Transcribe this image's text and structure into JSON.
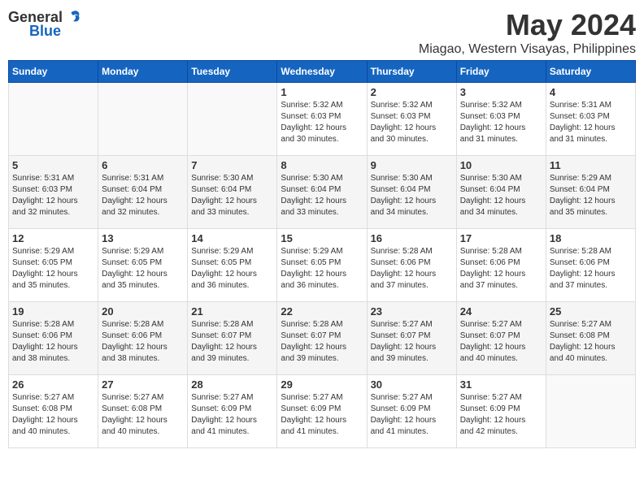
{
  "logo": {
    "text_general": "General",
    "text_blue": "Blue"
  },
  "title": "May 2024",
  "location": "Miagao, Western Visayas, Philippines",
  "days_of_week": [
    "Sunday",
    "Monday",
    "Tuesday",
    "Wednesday",
    "Thursday",
    "Friday",
    "Saturday"
  ],
  "weeks": [
    [
      {
        "day": "",
        "info": ""
      },
      {
        "day": "",
        "info": ""
      },
      {
        "day": "",
        "info": ""
      },
      {
        "day": "1",
        "info": "Sunrise: 5:32 AM\nSunset: 6:03 PM\nDaylight: 12 hours\nand 30 minutes."
      },
      {
        "day": "2",
        "info": "Sunrise: 5:32 AM\nSunset: 6:03 PM\nDaylight: 12 hours\nand 30 minutes."
      },
      {
        "day": "3",
        "info": "Sunrise: 5:32 AM\nSunset: 6:03 PM\nDaylight: 12 hours\nand 31 minutes."
      },
      {
        "day": "4",
        "info": "Sunrise: 5:31 AM\nSunset: 6:03 PM\nDaylight: 12 hours\nand 31 minutes."
      }
    ],
    [
      {
        "day": "5",
        "info": "Sunrise: 5:31 AM\nSunset: 6:03 PM\nDaylight: 12 hours\nand 32 minutes."
      },
      {
        "day": "6",
        "info": "Sunrise: 5:31 AM\nSunset: 6:04 PM\nDaylight: 12 hours\nand 32 minutes."
      },
      {
        "day": "7",
        "info": "Sunrise: 5:30 AM\nSunset: 6:04 PM\nDaylight: 12 hours\nand 33 minutes."
      },
      {
        "day": "8",
        "info": "Sunrise: 5:30 AM\nSunset: 6:04 PM\nDaylight: 12 hours\nand 33 minutes."
      },
      {
        "day": "9",
        "info": "Sunrise: 5:30 AM\nSunset: 6:04 PM\nDaylight: 12 hours\nand 34 minutes."
      },
      {
        "day": "10",
        "info": "Sunrise: 5:30 AM\nSunset: 6:04 PM\nDaylight: 12 hours\nand 34 minutes."
      },
      {
        "day": "11",
        "info": "Sunrise: 5:29 AM\nSunset: 6:04 PM\nDaylight: 12 hours\nand 35 minutes."
      }
    ],
    [
      {
        "day": "12",
        "info": "Sunrise: 5:29 AM\nSunset: 6:05 PM\nDaylight: 12 hours\nand 35 minutes."
      },
      {
        "day": "13",
        "info": "Sunrise: 5:29 AM\nSunset: 6:05 PM\nDaylight: 12 hours\nand 35 minutes."
      },
      {
        "day": "14",
        "info": "Sunrise: 5:29 AM\nSunset: 6:05 PM\nDaylight: 12 hours\nand 36 minutes."
      },
      {
        "day": "15",
        "info": "Sunrise: 5:29 AM\nSunset: 6:05 PM\nDaylight: 12 hours\nand 36 minutes."
      },
      {
        "day": "16",
        "info": "Sunrise: 5:28 AM\nSunset: 6:06 PM\nDaylight: 12 hours\nand 37 minutes."
      },
      {
        "day": "17",
        "info": "Sunrise: 5:28 AM\nSunset: 6:06 PM\nDaylight: 12 hours\nand 37 minutes."
      },
      {
        "day": "18",
        "info": "Sunrise: 5:28 AM\nSunset: 6:06 PM\nDaylight: 12 hours\nand 37 minutes."
      }
    ],
    [
      {
        "day": "19",
        "info": "Sunrise: 5:28 AM\nSunset: 6:06 PM\nDaylight: 12 hours\nand 38 minutes."
      },
      {
        "day": "20",
        "info": "Sunrise: 5:28 AM\nSunset: 6:06 PM\nDaylight: 12 hours\nand 38 minutes."
      },
      {
        "day": "21",
        "info": "Sunrise: 5:28 AM\nSunset: 6:07 PM\nDaylight: 12 hours\nand 39 minutes."
      },
      {
        "day": "22",
        "info": "Sunrise: 5:28 AM\nSunset: 6:07 PM\nDaylight: 12 hours\nand 39 minutes."
      },
      {
        "day": "23",
        "info": "Sunrise: 5:27 AM\nSunset: 6:07 PM\nDaylight: 12 hours\nand 39 minutes."
      },
      {
        "day": "24",
        "info": "Sunrise: 5:27 AM\nSunset: 6:07 PM\nDaylight: 12 hours\nand 40 minutes."
      },
      {
        "day": "25",
        "info": "Sunrise: 5:27 AM\nSunset: 6:08 PM\nDaylight: 12 hours\nand 40 minutes."
      }
    ],
    [
      {
        "day": "26",
        "info": "Sunrise: 5:27 AM\nSunset: 6:08 PM\nDaylight: 12 hours\nand 40 minutes."
      },
      {
        "day": "27",
        "info": "Sunrise: 5:27 AM\nSunset: 6:08 PM\nDaylight: 12 hours\nand 40 minutes."
      },
      {
        "day": "28",
        "info": "Sunrise: 5:27 AM\nSunset: 6:09 PM\nDaylight: 12 hours\nand 41 minutes."
      },
      {
        "day": "29",
        "info": "Sunrise: 5:27 AM\nSunset: 6:09 PM\nDaylight: 12 hours\nand 41 minutes."
      },
      {
        "day": "30",
        "info": "Sunrise: 5:27 AM\nSunset: 6:09 PM\nDaylight: 12 hours\nand 41 minutes."
      },
      {
        "day": "31",
        "info": "Sunrise: 5:27 AM\nSunset: 6:09 PM\nDaylight: 12 hours\nand 42 minutes."
      },
      {
        "day": "",
        "info": ""
      }
    ]
  ]
}
